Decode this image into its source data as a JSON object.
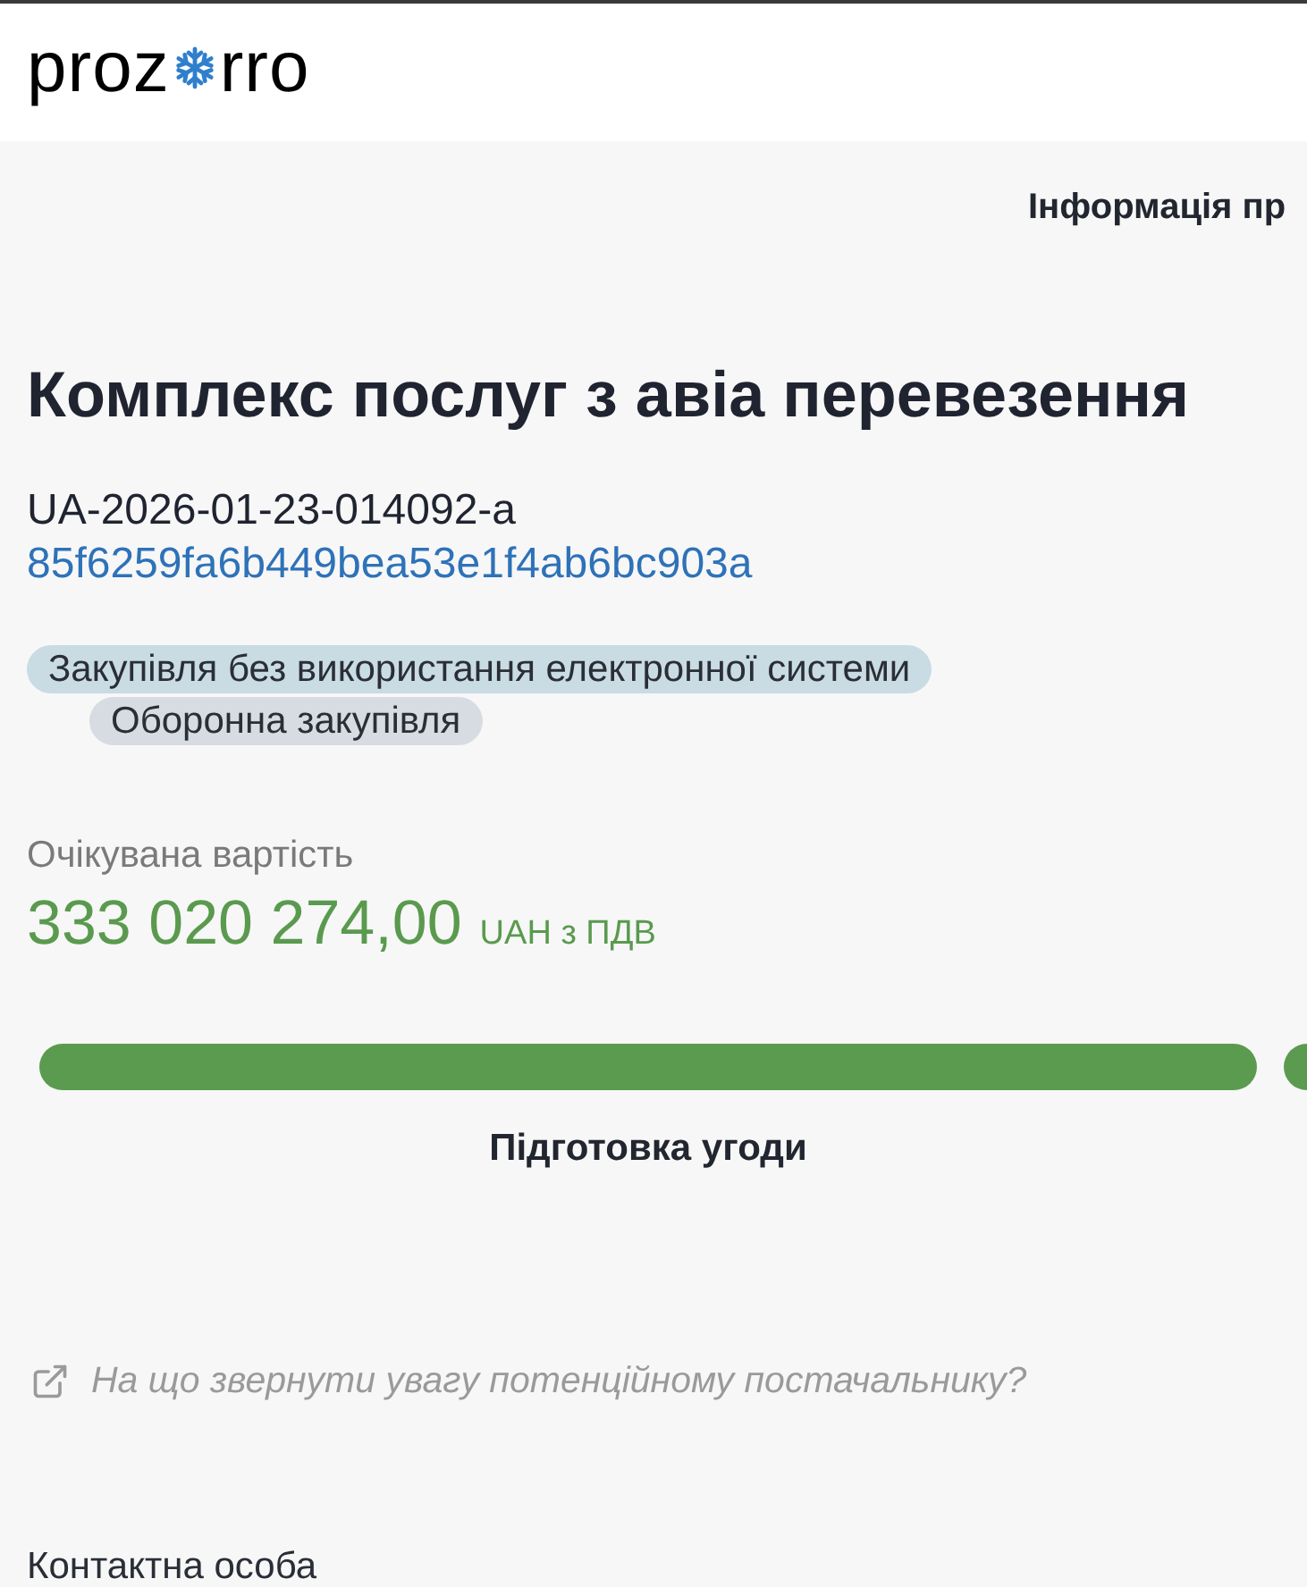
{
  "header": {
    "logo": {
      "text_before": "proz",
      "text_after": "rro"
    }
  },
  "nav": {
    "label": "Інформація пр"
  },
  "tender": {
    "title": "Комплекс послуг з авіа перевезення",
    "id": "UA-2026-01-23-014092-a",
    "hash": "85f6259fa6b449bea53e1f4ab6bc903a",
    "tags": [
      {
        "label": "Закупівля без використання електронної системи",
        "color": "#c9dbe3"
      },
      {
        "label": "Оборонна закупівля",
        "color": "#d6dce1"
      }
    ]
  },
  "expected_value": {
    "label": "Очікувана вартість",
    "amount": "333 020 274,00",
    "currency": "UAH з ПДВ"
  },
  "stages": [
    {
      "label": "Підготовка угоди",
      "done": true
    },
    {
      "done": true
    }
  ],
  "hint_link": {
    "text": "На що звернути увагу потенційному постачальнику?"
  },
  "contact": {
    "heading": "Контактна особа"
  }
}
